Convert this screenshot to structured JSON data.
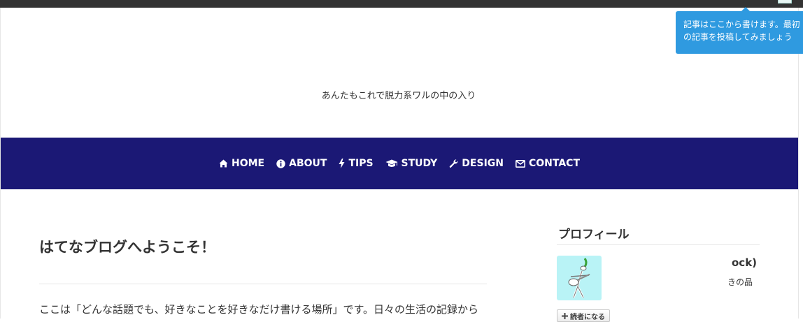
{
  "header": {
    "tagline": "あんたもこれで脱力系ワルの中の入り"
  },
  "nav": {
    "items": [
      {
        "label": "HOME",
        "icon": "home-icon"
      },
      {
        "label": "ABOUT",
        "icon": "info-icon"
      },
      {
        "label": "TIPS",
        "icon": "bolt-icon"
      },
      {
        "label": "STUDY",
        "icon": "graduation-cap-icon"
      },
      {
        "label": "DESIGN",
        "icon": "wrench-icon"
      },
      {
        "label": "CONTACT",
        "icon": "envelope-icon"
      }
    ]
  },
  "article": {
    "title": "はてなブログへようこそ！",
    "body": "ここは「どんな話題でも、好きなことを好きなだけ書ける場所」です。日々の生活の記録から"
  },
  "sidebar": {
    "profile_title": "プロフィール",
    "name_fragment": "ock)",
    "desc_fragment": "きの品",
    "subscribe_label": "読者になる"
  },
  "tooltip": {
    "line1": "記事はここから書けます。最初",
    "line2": "の記事を投稿してみましょう"
  },
  "colors": {
    "navbar": "#1b1875",
    "topbar": "#333333",
    "tooltip": "#2f9ae0",
    "avatar_bg": "#b9f3f6"
  }
}
